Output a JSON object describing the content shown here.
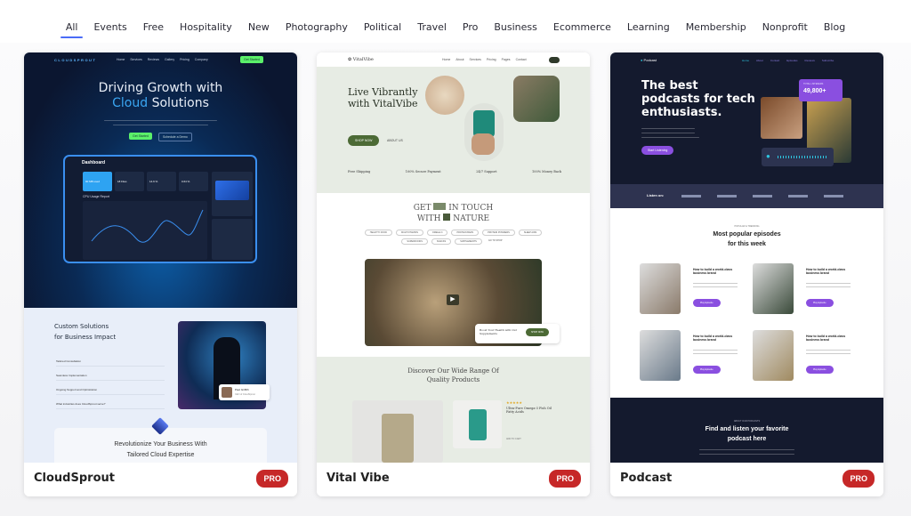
{
  "filters": {
    "active": "All",
    "items": [
      "All",
      "Events",
      "Free",
      "Hospitality",
      "New",
      "Photography",
      "Political",
      "Travel",
      "Pro",
      "Business",
      "Ecommerce",
      "Learning",
      "Membership",
      "Nonprofit",
      "Blog"
    ]
  },
  "accent_color": "#4a6cf7",
  "badge_color": "#c62828",
  "cards": [
    {
      "title": "CloudSprout",
      "badge": "PRO",
      "preview": {
        "logo": "CLOUDSPROUT",
        "nav": [
          "Home",
          "Services",
          "Reviews",
          "Gallery",
          "Pricing",
          "Company"
        ],
        "nav_cta": "Get Started",
        "heading_line1": "Driving Growth with",
        "heading_accent": "Cloud",
        "heading_rest": "Solutions",
        "primary_btn": "Get Started",
        "secondary_btn": "Schedule a Demo",
        "dashboard_title": "Dashboard",
        "stats": [
          "90 MB used",
          "18 Files",
          "14.6 %",
          "0.64 %"
        ],
        "chart_title": "CPU Usage Report",
        "section_heading_1": "Custom Solutions",
        "section_heading_2": "for Business Impact",
        "accordion": [
          "Tailored Consultation",
          "Seamless Implementation",
          "Ongoing Support and Optimization",
          "What industries does CloudSprout serve?"
        ],
        "person_name": "Paul Griffith",
        "person_role": "CEO of CloudSprout",
        "banner_line1": "Revolutionize Your Business With",
        "banner_line2": "Tailored Cloud Expertise"
      }
    },
    {
      "title": "Vital Vibe",
      "badge": "PRO",
      "preview": {
        "logo": "VitalVibe",
        "nav": [
          "Home",
          "About",
          "Services",
          "Pricing",
          "Pages",
          "Contact"
        ],
        "heading_line1": "Live Vibrantly",
        "heading_line2": "with VitalVibe",
        "primary_btn": "SHOP NOW",
        "secondary_btn": "ABOUT US",
        "features": [
          "Free Shipping",
          "100% Secure Payment",
          "24/7 Support",
          "100% Money Back"
        ],
        "touch_line1_a": "GET",
        "touch_line1_b": "IN TOUCH",
        "touch_line2_a": "WITH",
        "touch_line2_b": "NATURE",
        "chips": [
          "HEALTHY FOOD",
          "MULTIVITAMINS",
          "OMEGA-3",
          "PROTEIN BARS",
          "PROTEIN POWDERS",
          "SLEEP AIDS",
          "SUPERFOODS",
          "SNACKS",
          "SUPPLEMENTS"
        ],
        "chips_link": "GO TO SHOP",
        "video_cta_text": "Boost Your Health with Our Supplements",
        "video_cta_btn": "SHOP NOW",
        "products_heading_1": "Discover Our Wide Range Of",
        "products_heading_2": "Quality Products",
        "product_name": "Ultra-Pure Omega-3 Fish Oil Fatty Acids",
        "product_link": "ADD TO CART",
        "rating": 5
      }
    },
    {
      "title": "Podcast",
      "badge": "PRO",
      "preview": {
        "logo": "Podcast",
        "nav": [
          "Home",
          "About",
          "Contact",
          "Episodes",
          "Reviews",
          "Subscribe"
        ],
        "heading_1": "The best",
        "heading_2": "podcasts for tech",
        "heading_3": "enthusiasts.",
        "primary_btn": "Start Listening",
        "listeners_label": "TOTAL LISTENERS",
        "listeners_value": "49,800+",
        "listen_on": "Listen on:",
        "eyebrow": "POPULAR & TRENDING",
        "episodes_heading_1": "Most popular episodes",
        "episodes_heading_2": "for this week",
        "episode_title": "How to build a world-class business brand",
        "episode_btn": "Play Episode",
        "about_eyebrow": "ABOUT OUR PODCASTS",
        "footer_heading_1": "Find and listen your favorite",
        "footer_heading_2": "podcast here"
      }
    }
  ]
}
